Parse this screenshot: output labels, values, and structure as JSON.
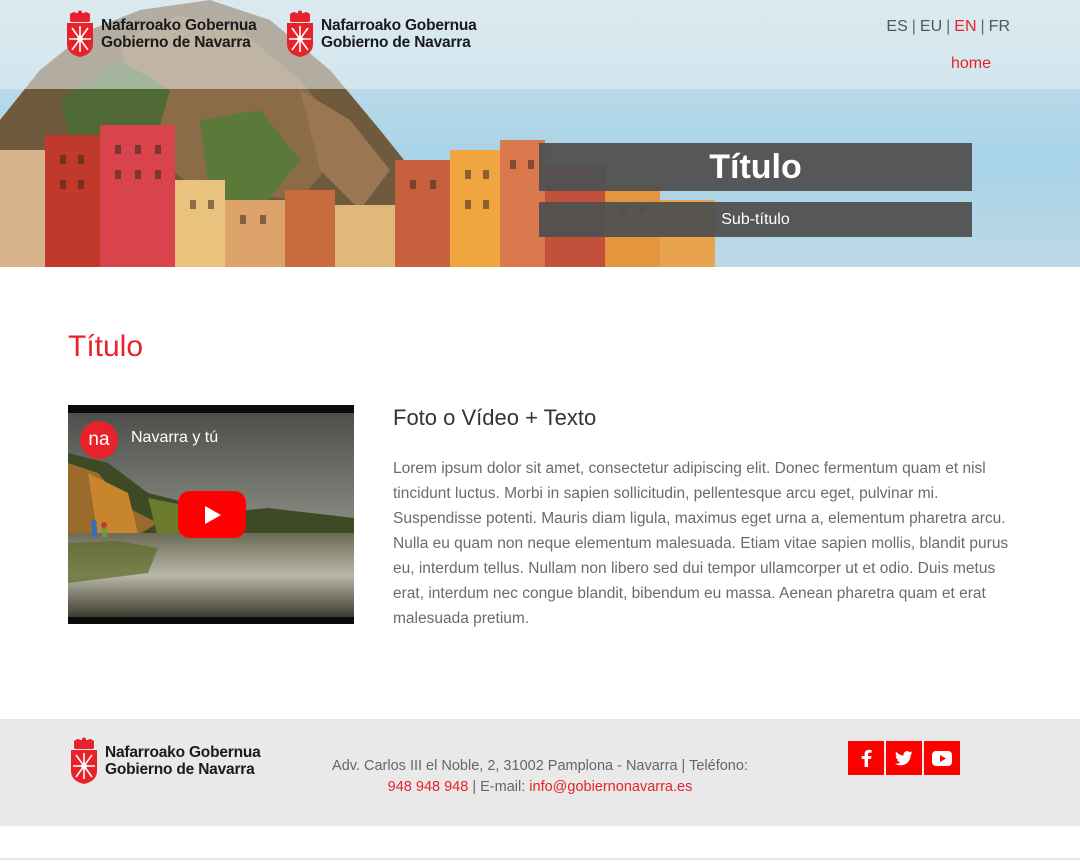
{
  "header": {
    "logo_line1": "Nafarroako Gobernua",
    "logo_line2": "Gobierno de Navarra",
    "languages": [
      "ES",
      "EU",
      "EN",
      "FR"
    ],
    "active_language": "EN",
    "home_label": "home"
  },
  "hero": {
    "title": "Título",
    "subtitle": "Sub-título"
  },
  "main": {
    "section_title": "Título",
    "video": {
      "channel_avatar": "na",
      "channel_name": "Navarra y tú"
    },
    "content_heading": "Foto o Vídeo + Texto",
    "content_body": "Lorem ipsum dolor sit amet, consectetur adipiscing elit. Donec fermentum quam et nisl tincidunt luctus. Morbi in sapien sollicitudin, pellentesque arcu eget, pulvinar mi. Suspendisse potenti. Mauris diam ligula, maximus eget urna a, elementum pharetra arcu. Nulla eu quam non neque elementum malesuada. Etiam vitae sapien mollis, blandit purus eu, interdum tellus. Nullam non libero sed dui tempor ullamcorper ut et odio. Duis metus erat, interdum nec congue blandit, bibendum eu massa. Aenean pharetra quam et erat malesuada pretium."
  },
  "footer": {
    "address_text": "Adv. Carlos III el Noble, 2, 31002 Pamplona - Navarra | Teléfono:",
    "phone": "948 948 948",
    "email_label": " | E-mail: ",
    "email": "info@gobiernonavarra.es",
    "social": [
      {
        "icon": "facebook-icon",
        "glyph": "f"
      },
      {
        "icon": "twitter-icon",
        "glyph": "t"
      },
      {
        "icon": "youtube-icon",
        "glyph": "▶"
      }
    ]
  },
  "colors": {
    "accent": "#e8222b",
    "youtube_red": "#ff0000",
    "hero_overlay": "#505050",
    "footer_bg": "#e9e9e9"
  }
}
